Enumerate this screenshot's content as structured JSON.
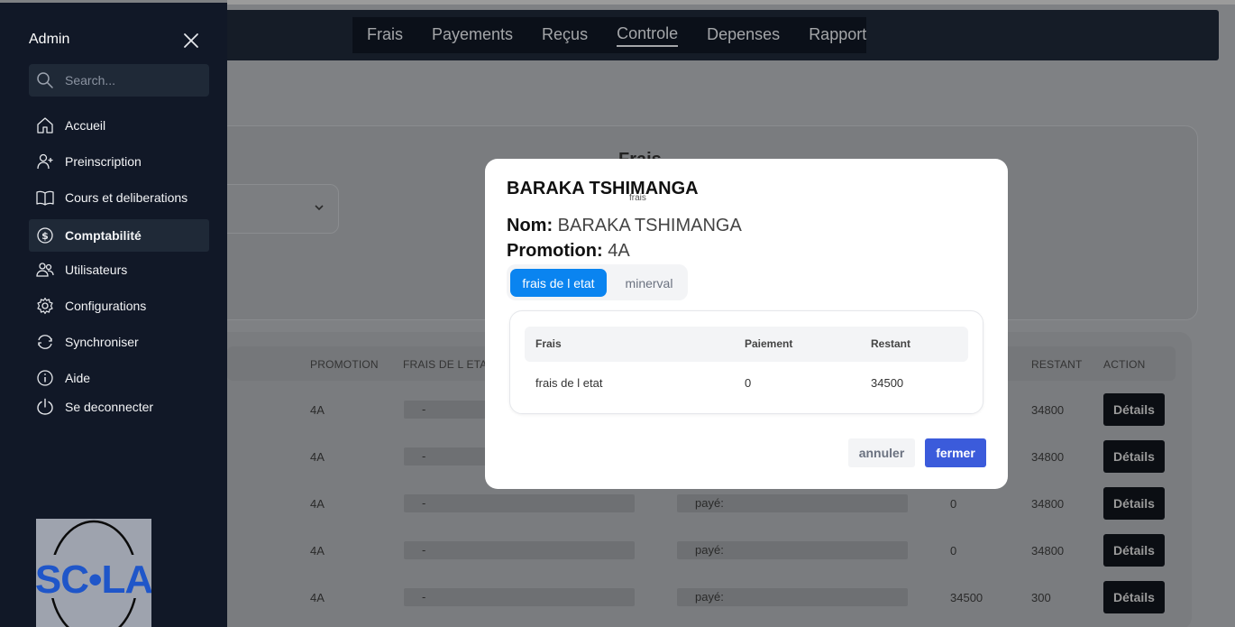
{
  "topnav": {
    "items": [
      {
        "label": "Frais"
      },
      {
        "label": "Payements"
      },
      {
        "label": "Reçus"
      },
      {
        "label": "Controle"
      },
      {
        "label": "Depenses"
      },
      {
        "label": "Rapport"
      }
    ],
    "active": "Controle"
  },
  "filter_card": {
    "title": "Frais"
  },
  "table": {
    "headers": {
      "promotion": "PROMOTION",
      "frais_etat": "FRAIS DE L ETAT",
      "restant": "RESTANT",
      "action": "ACTION"
    },
    "rows": [
      {
        "promotion": "4A",
        "frais_etat": "-",
        "paye": "",
        "paiement": "",
        "restant": "34800",
        "action": "Détails"
      },
      {
        "promotion": "4A",
        "frais_etat": "-",
        "paye": "",
        "paiement": "",
        "restant": "34800",
        "action": "Détails"
      },
      {
        "promotion": "4A",
        "frais_etat": "-",
        "paye": "payé:",
        "paiement": "0",
        "restant": "34800",
        "action": "Détails"
      },
      {
        "promotion": "4A",
        "frais_etat": "-",
        "paye": "payé:",
        "paiement": "0",
        "restant": "34800",
        "action": "Détails"
      },
      {
        "promotion": "4A",
        "frais_etat": "-",
        "paye": "payé:",
        "paiement": "34500",
        "restant": "300",
        "action": "Détails"
      }
    ]
  },
  "sidebar": {
    "title": "Admin",
    "search_placeholder": "Search...",
    "items": [
      {
        "label": "Accueil",
        "icon": "home-icon"
      },
      {
        "label": "Preinscription",
        "icon": "user-plus-icon"
      },
      {
        "label": "Cours et deliberations",
        "icon": "book-icon"
      },
      {
        "label": "Comptabilité",
        "icon": "dollar-circle-icon"
      },
      {
        "label": "Utilisateurs",
        "icon": "users-icon"
      },
      {
        "label": "Configurations",
        "icon": "gear-icon"
      },
      {
        "label": "Synchroniser",
        "icon": "sync-icon"
      },
      {
        "label": "Aide",
        "icon": "info-icon"
      },
      {
        "label": "Se deconnecter",
        "icon": "power-icon"
      }
    ],
    "active": "Comptabilité",
    "logo_text": "SCOLA"
  },
  "modal": {
    "title": "BARAKA TSHIMANGA",
    "subtitle": "frais",
    "nom_label": "Nom:",
    "nom_value": "BARAKA TSHIMANGA",
    "promotion_label": "Promotion:",
    "promotion_value": "4A",
    "tabs": [
      {
        "label": "frais de l etat"
      },
      {
        "label": "minerval"
      }
    ],
    "active_tab": "frais de l etat",
    "table": {
      "headers": {
        "frais": "Frais",
        "paiement": "Paiement",
        "restant": "Restant"
      },
      "rows": [
        {
          "frais": "frais de l etat",
          "paiement": "0",
          "restant": "34500"
        }
      ]
    },
    "cancel_label": "annuler",
    "close_label": "fermer"
  },
  "colors": {
    "sidebar_bg": "#111827",
    "primary_tab": "#0a84f0",
    "close_button": "#3b5bdb",
    "overlay": "#7f8184"
  }
}
